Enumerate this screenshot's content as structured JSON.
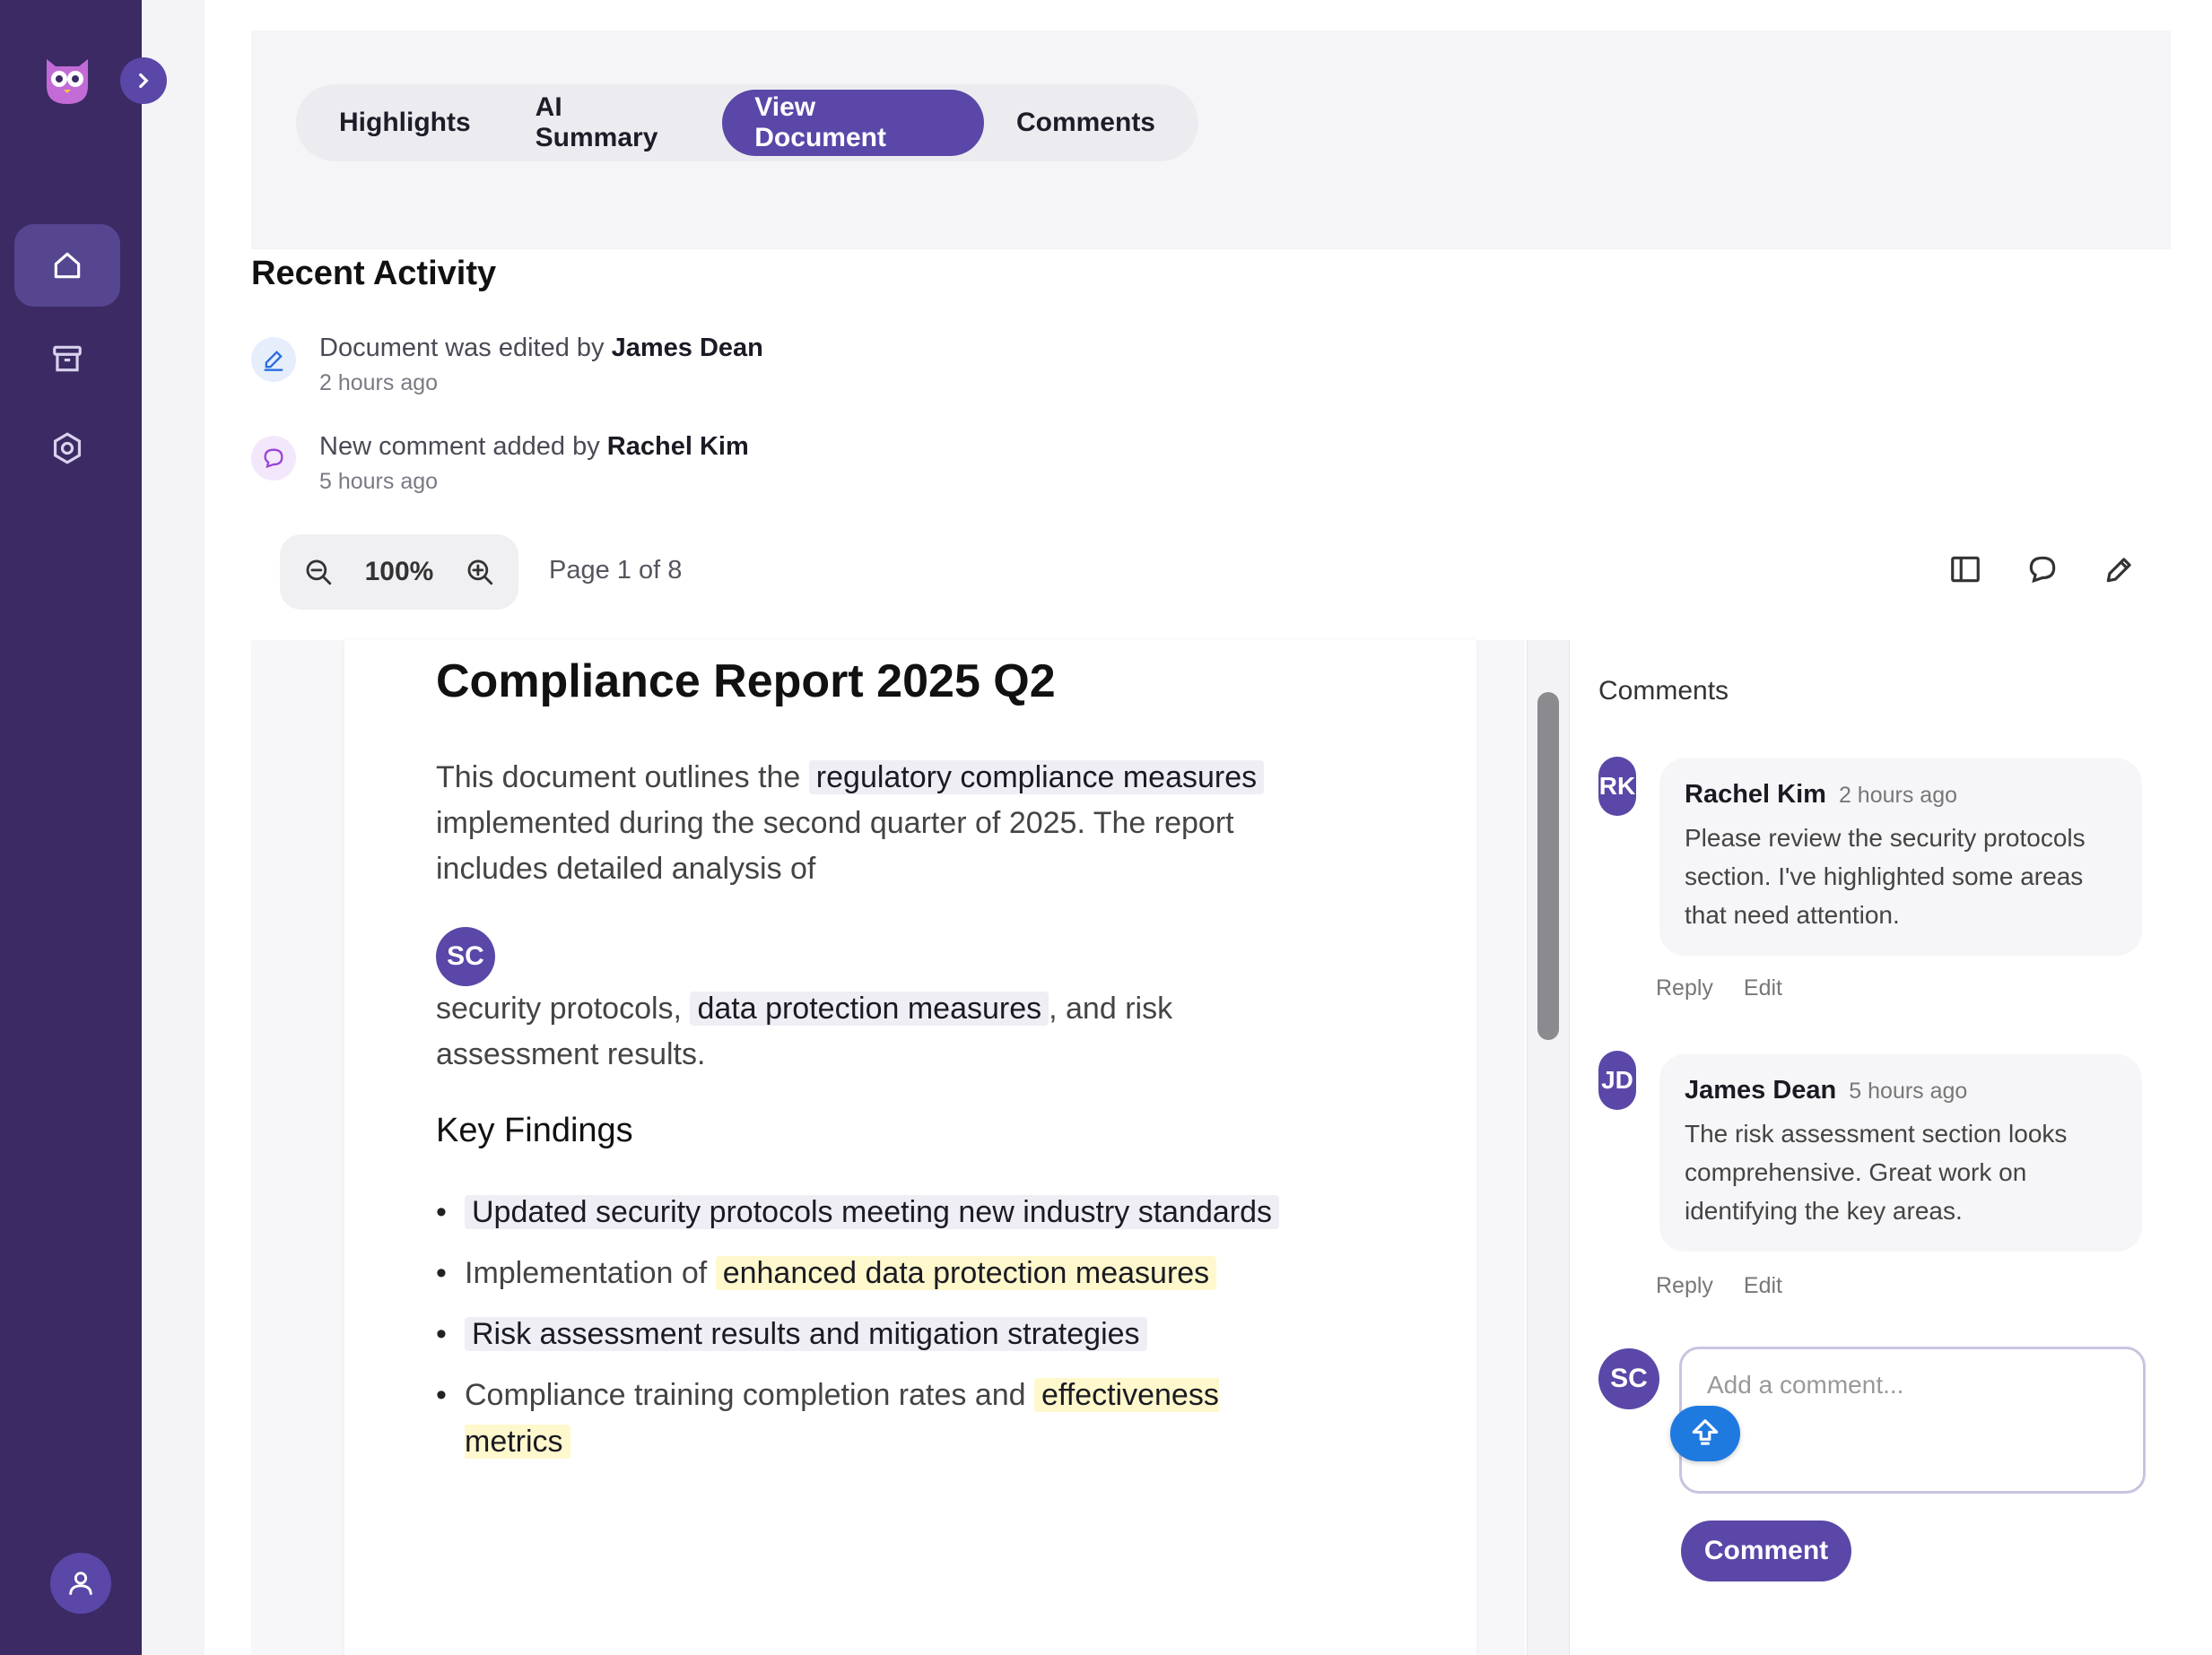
{
  "sidebar": {
    "logo": "owl-logo-icon",
    "collapse_icon": "chevron-right-icon",
    "items": [
      {
        "icon": "home-icon",
        "active": true
      },
      {
        "icon": "archive-icon",
        "active": false
      },
      {
        "icon": "settings-icon",
        "active": false
      }
    ],
    "user_icon": "user-icon"
  },
  "tabs": [
    {
      "label": "Highlights",
      "active": false
    },
    {
      "label": "AI Summary",
      "active": false
    },
    {
      "label": "View Document",
      "active": true
    },
    {
      "label": "Comments",
      "active": false
    }
  ],
  "recent_activity": {
    "title": "Recent Activity",
    "items": [
      {
        "text": "Document was edited by ",
        "user": "James Dean",
        "time": "2 hours ago",
        "icon": "pencil-icon"
      },
      {
        "text": "New comment added by ",
        "user": "Rachel Kim",
        "time": "5 hours ago",
        "icon": "comment-icon"
      }
    ]
  },
  "toolbar": {
    "zoom": "100%",
    "page_info": "Page 1 of 8",
    "icons": [
      "sidebar-panel-icon",
      "comment-icon",
      "pen-icon"
    ]
  },
  "document": {
    "title": "Compliance Report 2025 Q2",
    "p1_a": "This document outlines the ",
    "p1_hl": "regulatory compliance measures",
    "p1_b": " implemented during the second quarter of 2025. The report includes detailed analysis of ",
    "avatar_initials": "SC",
    "p2_a": "security protocols, ",
    "p2_hl": "data protection measures",
    "p2_b": ", and risk assessment results.",
    "key_findings_title": "Key Findings",
    "findings": {
      "f1": "Updated security protocols meeting new industry standards",
      "f2_a": "Implementation of ",
      "f2_hl": "enhanced data protection measures",
      "f3": "Risk assessment results and mitigation strategies",
      "f4_a": "Compliance training completion rates and ",
      "f4_hl": "effectiveness metrics"
    }
  },
  "comments_panel": {
    "title": "Comments",
    "comments": [
      {
        "initials": "RK",
        "author": "Rachel Kim",
        "time": "2 hours ago",
        "text": "Please review the security protocols section. I've highlighted some areas that need attention.",
        "reply": "Reply",
        "edit": "Edit"
      },
      {
        "initials": "JD",
        "author": "James Dean",
        "time": "5 hours ago",
        "text": "The risk assessment section looks comprehensive. Great work on identifying the key areas.",
        "reply": "Reply",
        "edit": "Edit"
      }
    ],
    "current_user_initials": "SC",
    "input_placeholder": "Add a comment...",
    "submit_label": "Comment"
  },
  "colors": {
    "sidebar_bg": "#3b2a63",
    "accent": "#5a47a8",
    "highlight_yellow": "#fff8cc",
    "highlight_gray": "#eeeef4",
    "float_button": "#1f7ae0"
  }
}
